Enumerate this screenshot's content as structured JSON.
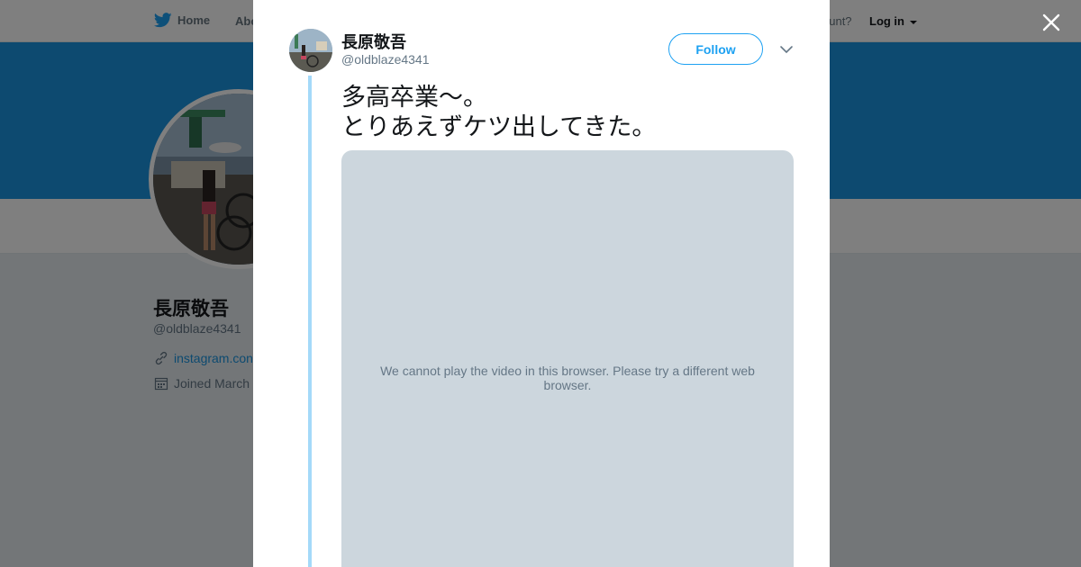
{
  "header": {
    "home_label": "Home",
    "about_label": "Abo",
    "account_prompt": "ccount?",
    "login_label": "Log in"
  },
  "profile": {
    "name": "長原敬吾",
    "handle": "@oldblaze4341",
    "link": "instagram.con",
    "joined": "Joined March"
  },
  "tweet": {
    "author_name": "長原敬吾",
    "author_handle": "@oldblaze4341",
    "follow_label": "Follow",
    "text_lines": [
      "多高卒業～。",
      "とりあえずケツ出してきた。"
    ],
    "video_message": "We cannot play the video in this browser. Please try a different web browser."
  },
  "icons": {
    "brand": "twitter-bird-icon",
    "close": "close-icon",
    "caret": "chevron-down-icon",
    "link": "link-icon",
    "calendar": "calendar-icon"
  },
  "colors": {
    "brand_blue": "#1da1f2",
    "banner": "#1b95e0",
    "thread_line": "#a4d9f9",
    "media_placeholder": "#ccd6dd"
  }
}
